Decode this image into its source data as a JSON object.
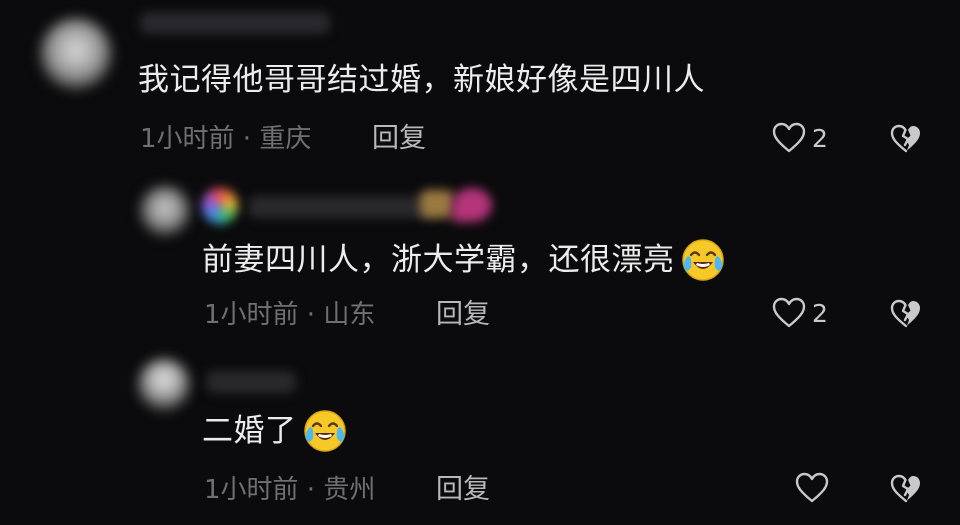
{
  "comments": [
    {
      "text": "我记得他哥哥结过婚，新娘好像是四川人",
      "meta": "1小时前 · 重庆",
      "reply_label": "回复",
      "like_count": "2",
      "emoji": ""
    },
    {
      "text": "前妻四川人，浙大学霸，还很漂亮",
      "meta": "1小时前 · 山东",
      "reply_label": "回复",
      "like_count": "2",
      "emoji": "crying-laughing-emoji"
    },
    {
      "text": "二婚了",
      "meta": "1小时前 · 贵州",
      "reply_label": "回复",
      "like_count": "",
      "emoji": "crying-laughing-emoji"
    }
  ],
  "icons": {
    "like": "heart-outline-icon",
    "dislike": "broken-heart-icon"
  },
  "colors": {
    "background": "#0b0b0d",
    "text": "#ececec",
    "meta": "#6f6f74",
    "reply": "#b8b8bc",
    "emoji_face": "#f7c928"
  }
}
